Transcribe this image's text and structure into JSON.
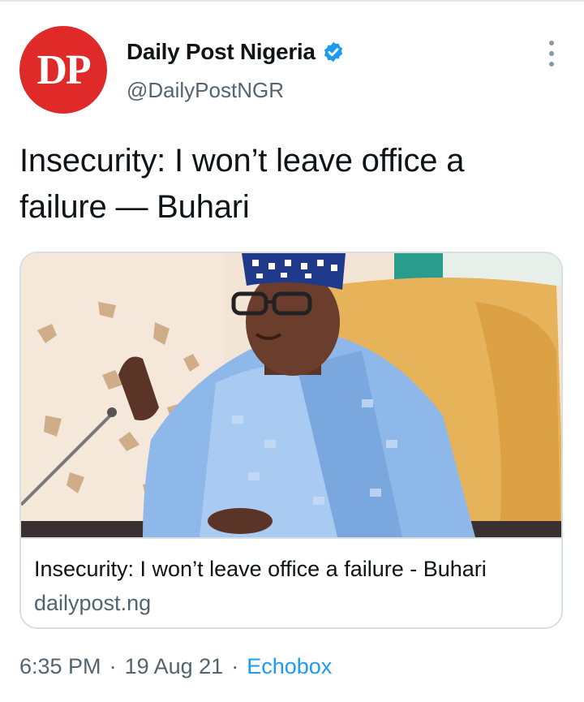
{
  "tweet": {
    "author": {
      "avatar_text": "DP",
      "display_name": "Daily Post Nigeria",
      "handle": "@DailyPostNGR",
      "verified": true
    },
    "text": "Insecurity: I won’t leave office a failure — Buhari",
    "card": {
      "title": "Insecurity: I won’t leave office a failure - Buhari",
      "domain": "dailypost.ng"
    },
    "meta": {
      "time": "6:35 PM",
      "separator": "·",
      "date": "19 Aug 21",
      "source": "Echobox"
    }
  },
  "icons": {
    "more": "more-vertical-icon",
    "verified": "verified-badge-icon"
  },
  "colors": {
    "avatar_bg": "#e02a2a",
    "verified": "#1d9bf0",
    "link": "#1d9bf0",
    "secondary_text": "#536471"
  }
}
